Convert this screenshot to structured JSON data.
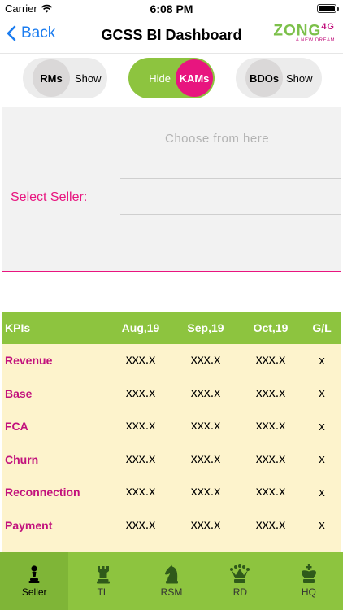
{
  "status": {
    "carrier": "Carrier",
    "time": "6:08 PM"
  },
  "nav": {
    "back_label": "Back",
    "title": "GCSS BI Dashboard"
  },
  "logo": {
    "brand": "ZONG",
    "suffix": "4G",
    "tagline": "A NEW DREAM"
  },
  "toggles": [
    {
      "name": "RMs",
      "state_label": "Show",
      "on": false
    },
    {
      "name": "KAMs",
      "state_label": "Hide",
      "on": true
    },
    {
      "name": "BDOs",
      "state_label": "Show",
      "on": false
    }
  ],
  "seller": {
    "placeholder": "Choose from here",
    "label": "Select Seller:"
  },
  "kpi_table": {
    "headers": [
      "KPIs",
      "Aug,19",
      "Sep,19",
      "Oct,19",
      "G/L"
    ],
    "rows": [
      [
        "Revenue",
        "xxx.x",
        "xxx.x",
        "xxx.x",
        "x"
      ],
      [
        "Base",
        "xxx.x",
        "xxx.x",
        "xxx.x",
        "x"
      ],
      [
        "FCA",
        "xxx.x",
        "xxx.x",
        "xxx.x",
        "x"
      ],
      [
        "Churn",
        "xxx.x",
        "xxx.x",
        "xxx.x",
        "x"
      ],
      [
        "Reconnection",
        "xxx.x",
        "xxx.x",
        "xxx.x",
        "x"
      ],
      [
        "Payment",
        "xxx.x",
        "xxx.x",
        "xxx.x",
        "x"
      ]
    ]
  },
  "tabs": [
    {
      "label": "Seller",
      "icon": "pawn-icon",
      "active": true
    },
    {
      "label": "TL",
      "icon": "rook-icon",
      "active": false
    },
    {
      "label": "RSM",
      "icon": "knight-icon",
      "active": false
    },
    {
      "label": "RD",
      "icon": "queen-icon",
      "active": false
    },
    {
      "label": "HQ",
      "icon": "king-icon",
      "active": false
    }
  ],
  "colors": {
    "accent_green": "#8dc43f",
    "accent_magenta": "#e8157f",
    "ios_blue": "#1a7cf0",
    "table_body": "#fdf3cc"
  }
}
